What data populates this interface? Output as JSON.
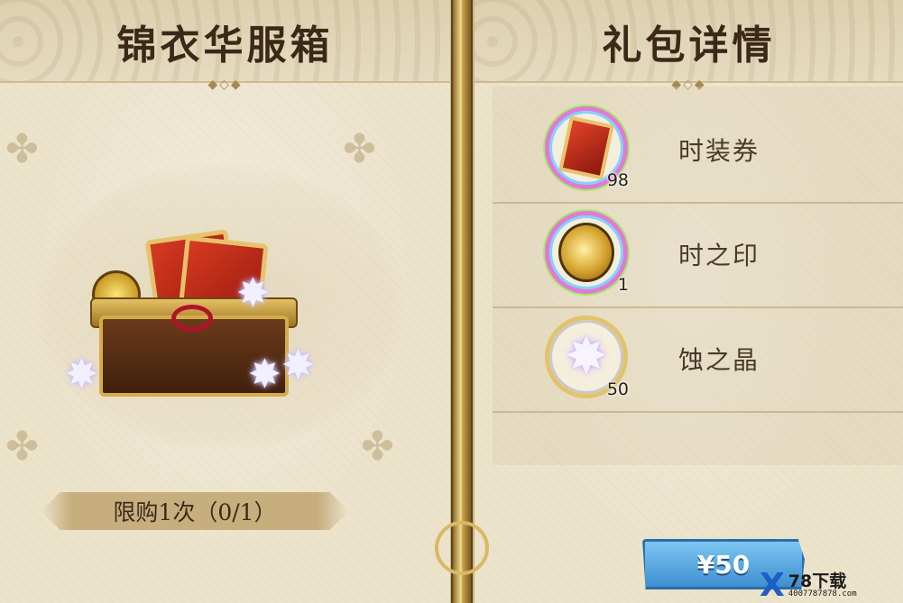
{
  "left_panel": {
    "title": "锦衣华服箱",
    "purchase_limit": "限购1次（0/1）"
  },
  "right_panel": {
    "title": "礼包详情",
    "items": [
      {
        "name": "时装券",
        "quantity": "98",
        "icon": "costume-ticket-icon"
      },
      {
        "name": "时之印",
        "quantity": "1",
        "icon": "time-seal-coin-icon"
      },
      {
        "name": "蚀之晶",
        "quantity": "50",
        "icon": "eclipse-crystal-icon"
      }
    ]
  },
  "price_button": {
    "label": "¥50"
  },
  "watermark": {
    "main": "78下载",
    "sub": "4007787878.com"
  },
  "colors": {
    "parchment": "#ece3cb",
    "title_text": "#3b2818",
    "price_button": "#4f9fdb",
    "divider_gold": "#d9b866"
  }
}
